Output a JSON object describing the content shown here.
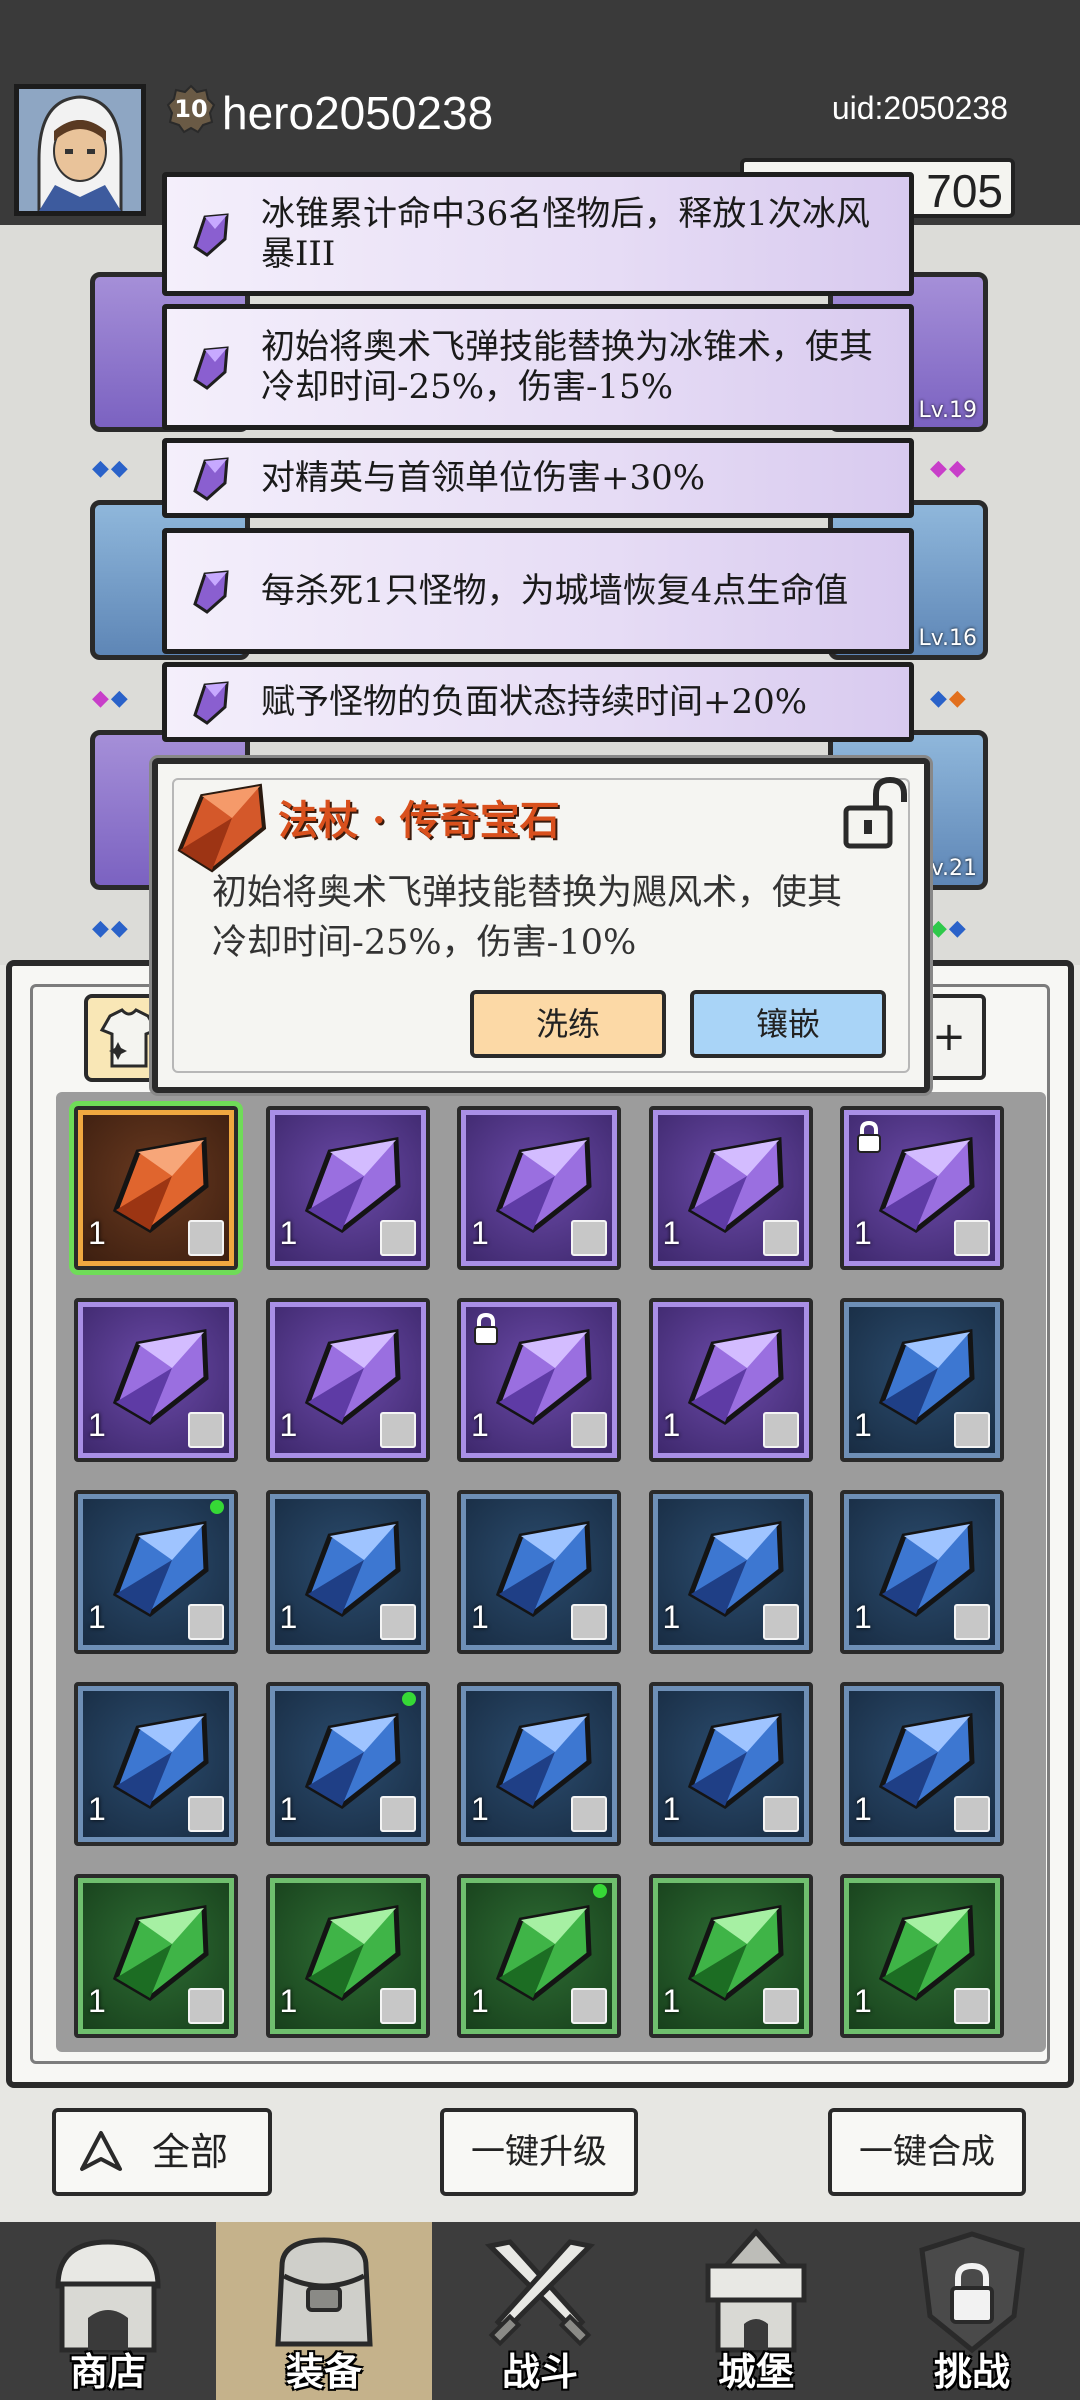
{
  "player": {
    "level": "10",
    "username": "hero2050238",
    "uid": "uid:2050238",
    "gold": "705"
  },
  "equipment": {
    "slots": [
      {
        "quality": "purple",
        "level": ""
      },
      {
        "quality": "purple",
        "level": "Lv.19"
      },
      {
        "quality": "blue",
        "level": ""
      },
      {
        "quality": "blue",
        "level": "Lv.16"
      },
      {
        "quality": "purple",
        "level": ""
      },
      {
        "quality": "blue",
        "level": "Lv.21"
      }
    ]
  },
  "affixes": [
    {
      "text": "冰锥累计命中36名怪物后，释放1次冰风暴III"
    },
    {
      "text": "初始将奥术飞弹技能替换为冰锥术，使其冷却时间-25%，伤害-15%"
    },
    {
      "text": "对精英与首领单位伤害+30%"
    },
    {
      "text": "每杀死1只怪物，为城墙恢复4点生命值"
    },
    {
      "text": "赋予怪物的负面状态持续时间+20%"
    }
  ],
  "popup": {
    "title": "法杖 · 传奇宝石",
    "description": "初始将奥术飞弹技能替换为飓风术，使其冷却时间-25%，伤害-10%",
    "refine_label": "洗练",
    "inlay_label": "镶嵌",
    "lock_icon": "unlocked-padlock-icon"
  },
  "inventory": {
    "sort_label": "+",
    "gems": [
      {
        "quality": "orange",
        "count": "1",
        "slot": "staff",
        "locked": false,
        "new": false
      },
      {
        "quality": "purple",
        "count": "1",
        "slot": "boots",
        "locked": false,
        "new": false
      },
      {
        "quality": "purple",
        "count": "1",
        "slot": "boots",
        "locked": false,
        "new": false
      },
      {
        "quality": "purple",
        "count": "1",
        "slot": "staff",
        "locked": false,
        "new": false
      },
      {
        "quality": "purple",
        "count": "1",
        "slot": "staff",
        "locked": true,
        "new": false
      },
      {
        "quality": "purple",
        "count": "1",
        "slot": "staff",
        "locked": false,
        "new": false
      },
      {
        "quality": "purple",
        "count": "1",
        "slot": "staff",
        "locked": false,
        "new": false
      },
      {
        "quality": "purple",
        "count": "1",
        "slot": "staff",
        "locked": true,
        "new": false
      },
      {
        "quality": "purple",
        "count": "1",
        "slot": "hat",
        "locked": false,
        "new": false
      },
      {
        "quality": "blue",
        "count": "1",
        "slot": "ring",
        "locked": false,
        "new": false
      },
      {
        "quality": "blue",
        "count": "1",
        "slot": "ring",
        "locked": false,
        "new": true
      },
      {
        "quality": "blue",
        "count": "1",
        "slot": "armor",
        "locked": false,
        "new": false
      },
      {
        "quality": "blue",
        "count": "1",
        "slot": "armor",
        "locked": false,
        "new": false
      },
      {
        "quality": "blue",
        "count": "1",
        "slot": "boots",
        "locked": false,
        "new": false
      },
      {
        "quality": "blue",
        "count": "1",
        "slot": "boots",
        "locked": false,
        "new": false
      },
      {
        "quality": "blue",
        "count": "1",
        "slot": "boots",
        "locked": false,
        "new": false
      },
      {
        "quality": "blue",
        "count": "1",
        "slot": "hat",
        "locked": false,
        "new": true
      },
      {
        "quality": "blue",
        "count": "1",
        "slot": "ring-h",
        "locked": false,
        "new": false
      },
      {
        "quality": "blue",
        "count": "1",
        "slot": "ring-h",
        "locked": false,
        "new": false
      },
      {
        "quality": "blue",
        "count": "1",
        "slot": "ring-h",
        "locked": false,
        "new": false
      },
      {
        "quality": "green",
        "count": "1",
        "slot": "ring",
        "locked": false,
        "new": false
      },
      {
        "quality": "green",
        "count": "1",
        "slot": "ring",
        "locked": false,
        "new": false
      },
      {
        "quality": "green",
        "count": "1",
        "slot": "ring",
        "locked": false,
        "new": true
      },
      {
        "quality": "green",
        "count": "1",
        "slot": "ring",
        "locked": false,
        "new": false
      },
      {
        "quality": "green",
        "count": "1",
        "slot": "armor",
        "locked": false,
        "new": false
      }
    ]
  },
  "actions": {
    "filter_label": "全部",
    "upgrade_all_label": "一键升级",
    "merge_all_label": "一键合成"
  },
  "nav": [
    {
      "label": "商店",
      "icon": "shop-icon"
    },
    {
      "label": "装备",
      "icon": "backpack-icon"
    },
    {
      "label": "战斗",
      "icon": "crossed-swords-icon"
    },
    {
      "label": "城堡",
      "icon": "castle-icon"
    },
    {
      "label": "挑战",
      "icon": "locked-shield-icon"
    }
  ],
  "colors": {
    "purple": "#6b4aa8",
    "blue": "#2b4c6e",
    "green": "#2e6d34",
    "orange": "#d9501d",
    "new_dot": "#36d836"
  }
}
